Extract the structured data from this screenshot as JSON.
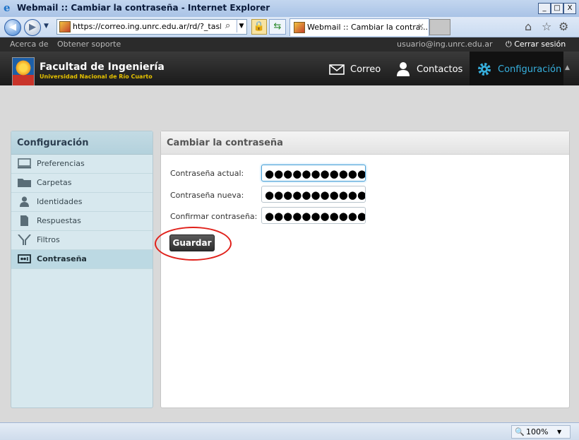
{
  "window": {
    "title": "Webmail :: Cambiar la contraseña - Internet Explorer",
    "controls": {
      "minimize": "_",
      "maximize": "□",
      "close": "X"
    }
  },
  "browser": {
    "url": "https://correo.ing.unrc.edu.ar/rd/?_task=se",
    "tab_label": "Webmail :: Cambiar la contra...",
    "tab_close": "×",
    "zoom": "100%"
  },
  "topbar": {
    "about": "Acerca de",
    "support": "Obtener soporte",
    "user": "usuario@ing.unrc.edu.ar",
    "logout": "Cerrar sesión"
  },
  "logo": {
    "title": "Facultad de Ingeniería",
    "subtitle": "Universidad Nacional de Río Cuarto"
  },
  "nav": {
    "mail": "Correo",
    "contacts": "Contactos",
    "settings": "Configuración"
  },
  "sidebar": {
    "heading": "Configuración",
    "items": [
      {
        "label": "Preferencias",
        "icon": "monitor-icon"
      },
      {
        "label": "Carpetas",
        "icon": "folder-icon"
      },
      {
        "label": "Identidades",
        "icon": "person-icon"
      },
      {
        "label": "Respuestas",
        "icon": "document-icon"
      },
      {
        "label": "Filtros",
        "icon": "filter-icon"
      },
      {
        "label": "Contraseña",
        "icon": "password-icon",
        "selected": true
      }
    ]
  },
  "panel": {
    "heading": "Cambiar la contraseña",
    "fields": {
      "current_label": "Contraseña actual:",
      "current_value": "●●●●●●●●●●●●",
      "new_label": "Contraseña nueva:",
      "new_value": "●●●●●●●●●●●●●●",
      "confirm_label": "Confirmar contraseña:",
      "confirm_value": "●●●●●●●●●●●●●●"
    },
    "save_label": "Guardar"
  },
  "colors": {
    "header_bg": "#1f1f1f",
    "accent": "#37b0de",
    "sidebar_bg": "#d7e8ee",
    "highlight_circle": "#e0201a"
  }
}
